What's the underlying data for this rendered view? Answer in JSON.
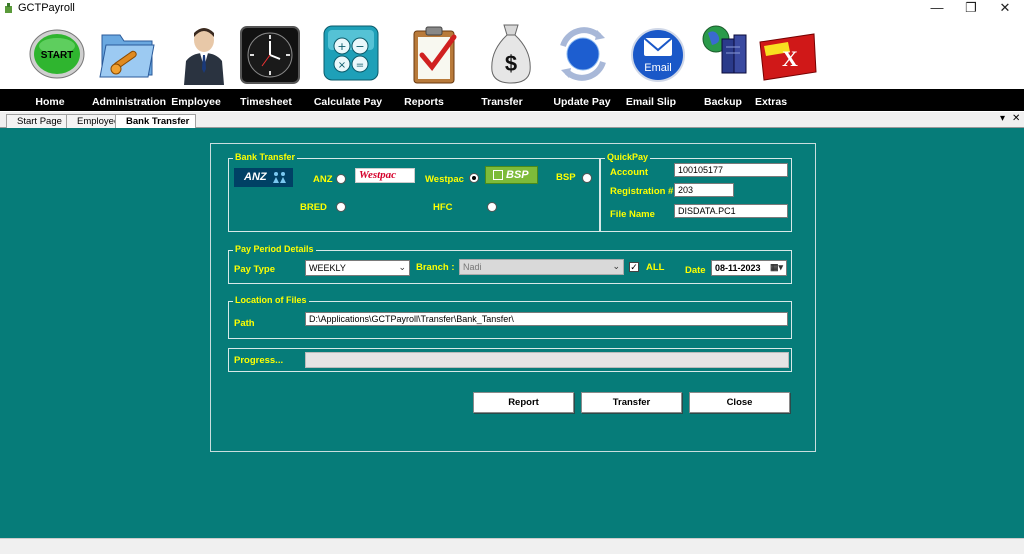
{
  "window": {
    "title": "GCTPayroll",
    "controls": {
      "minimize": "—",
      "restore": "❐",
      "close": "✕"
    }
  },
  "toolbar": {
    "items": [
      {
        "label": "Home",
        "icon": "start-icon",
        "icon_text": "START"
      },
      {
        "label": "Administration",
        "icon": "admin-folder-icon"
      },
      {
        "label": "Employee",
        "icon": "employee-person-icon"
      },
      {
        "label": "Timesheet",
        "icon": "clock-icon"
      },
      {
        "label": "Calculate Pay",
        "icon": "calculator-icon"
      },
      {
        "label": "Reports",
        "icon": "clipboard-check-icon"
      },
      {
        "label": "Transfer",
        "icon": "money-bag-icon",
        "icon_text": "$"
      },
      {
        "label": "Update Pay",
        "icon": "refresh-globe-icon"
      },
      {
        "label": "Email Slip",
        "icon": "email-icon",
        "icon_text": "Email"
      },
      {
        "label": "Backup",
        "icon": "backup-server-icon"
      },
      {
        "label": "Extras",
        "icon": "exit-x-icon",
        "icon_text": "X"
      }
    ]
  },
  "tabs": {
    "items": [
      {
        "label": "Start Page",
        "active": false
      },
      {
        "label": "Employee",
        "active": false
      },
      {
        "label": "Bank Transfer",
        "active": true
      }
    ],
    "controls": {
      "dropdown": "▾",
      "close": "✕"
    }
  },
  "bank_transfer": {
    "title": "Bank Transfer",
    "banks": [
      {
        "label": "ANZ",
        "logo_text": "ANZ",
        "selected": false
      },
      {
        "label": "Westpac",
        "logo_text": "Westpac",
        "selected": true
      },
      {
        "label": "BSP",
        "logo_text": "BSP",
        "selected": false
      },
      {
        "label": "BRED",
        "selected": false
      },
      {
        "label": "HFC",
        "selected": false
      }
    ]
  },
  "quickpay": {
    "title": "QuickPay",
    "account_label": "Account",
    "account_value": "100105177",
    "registration_label": "Registration #",
    "registration_value": "203",
    "filename_label": "File Name",
    "filename_value": "DISDATA.PC1"
  },
  "pay_period": {
    "title": "Pay Period Details",
    "pay_type_label": "Pay Type",
    "pay_type_value": "WEEKLY",
    "branch_label": "Branch :",
    "branch_value": "Nadi",
    "all_label": "ALL",
    "all_checked": true,
    "date_label": "Date",
    "date_value": "08-11-2023"
  },
  "location": {
    "title": "Location of Files",
    "path_label": "Path",
    "path_value": "D:\\Applications\\GCTPayroll\\Transfer\\Bank_Tansfer\\"
  },
  "progress": {
    "label": "Progress...",
    "value": 0
  },
  "buttons": {
    "report": "Report",
    "transfer": "Transfer",
    "close": "Close"
  },
  "colors": {
    "workspace": "#067c79",
    "label_yellow": "#ffff00",
    "menubar": "#000000",
    "westpac_red": "#d5002b",
    "anz_blue": "#004165",
    "bsp_green": "#7dbb3a"
  }
}
